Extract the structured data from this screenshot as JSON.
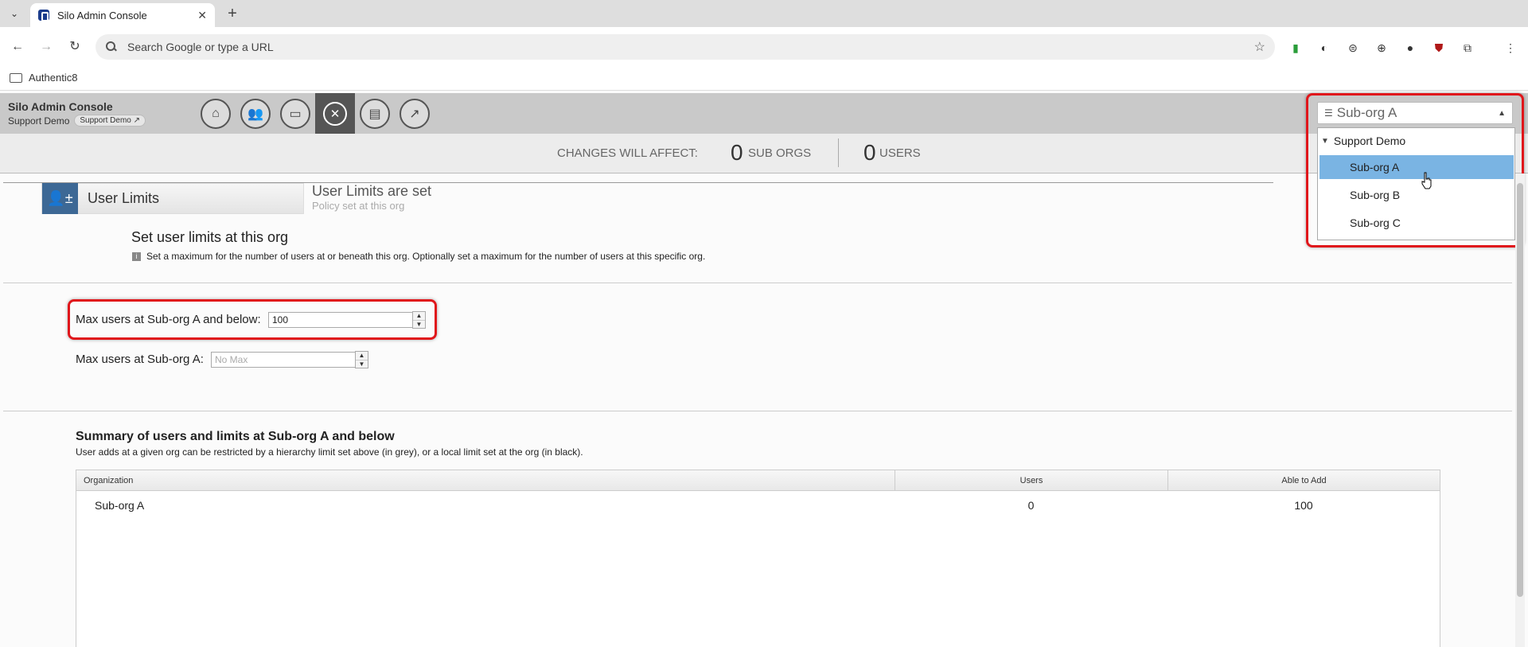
{
  "browser": {
    "tab_title": "Silo Admin Console",
    "omnibox_placeholder": "Search Google or type a URL",
    "bookmark_folder": "Authentic8"
  },
  "app": {
    "title": "Silo Admin Console",
    "org_name": "Support Demo",
    "org_pill": "Support Demo",
    "nav_icons": [
      "home-icon",
      "users-icon",
      "window-icon",
      "tools-icon",
      "report-icon",
      "chart-icon"
    ],
    "org_select": {
      "value": "Sub-org A",
      "tree_icon": "☰",
      "caret": "▲"
    }
  },
  "affect": {
    "label": "CHANGES WILL AFFECT:",
    "sub_orgs_count": "0",
    "sub_orgs_label": "SUB ORGS",
    "users_count": "0",
    "users_label": "USERS"
  },
  "dropdown": {
    "parent": "Support Demo",
    "items": [
      "Sub-org A",
      "Sub-org B",
      "Sub-org C"
    ],
    "selected": "Sub-org A"
  },
  "section": {
    "title": "User Limits",
    "status_title": "User Limits are set",
    "status_sub": "Policy set at this org"
  },
  "set_limits": {
    "title": "Set user limits at this org",
    "info": "Set a maximum for the number of users at or beneath this org. Optionally set a maximum for the number of users at this specific org."
  },
  "fields": {
    "max_below_label": "Max users at Sub-org A and below:",
    "max_below_value": "100",
    "max_at_label": "Max users at Sub-org A:",
    "max_at_placeholder": "No Max"
  },
  "summary": {
    "title": "Summary of users and limits at Sub-org A and below",
    "subtitle": "User adds at a given org can be restricted by a hierarchy limit set above (in grey), or a local limit set at the org (in black).",
    "columns": [
      "Organization",
      "Users",
      "Able to Add"
    ],
    "rows": [
      {
        "organization": "Sub-org A",
        "users": "0",
        "able_to_add": "100"
      }
    ]
  },
  "colors": {
    "highlight": "#e0161b",
    "selected_item": "#7ab4e3",
    "section_icon": "#3d6895"
  }
}
